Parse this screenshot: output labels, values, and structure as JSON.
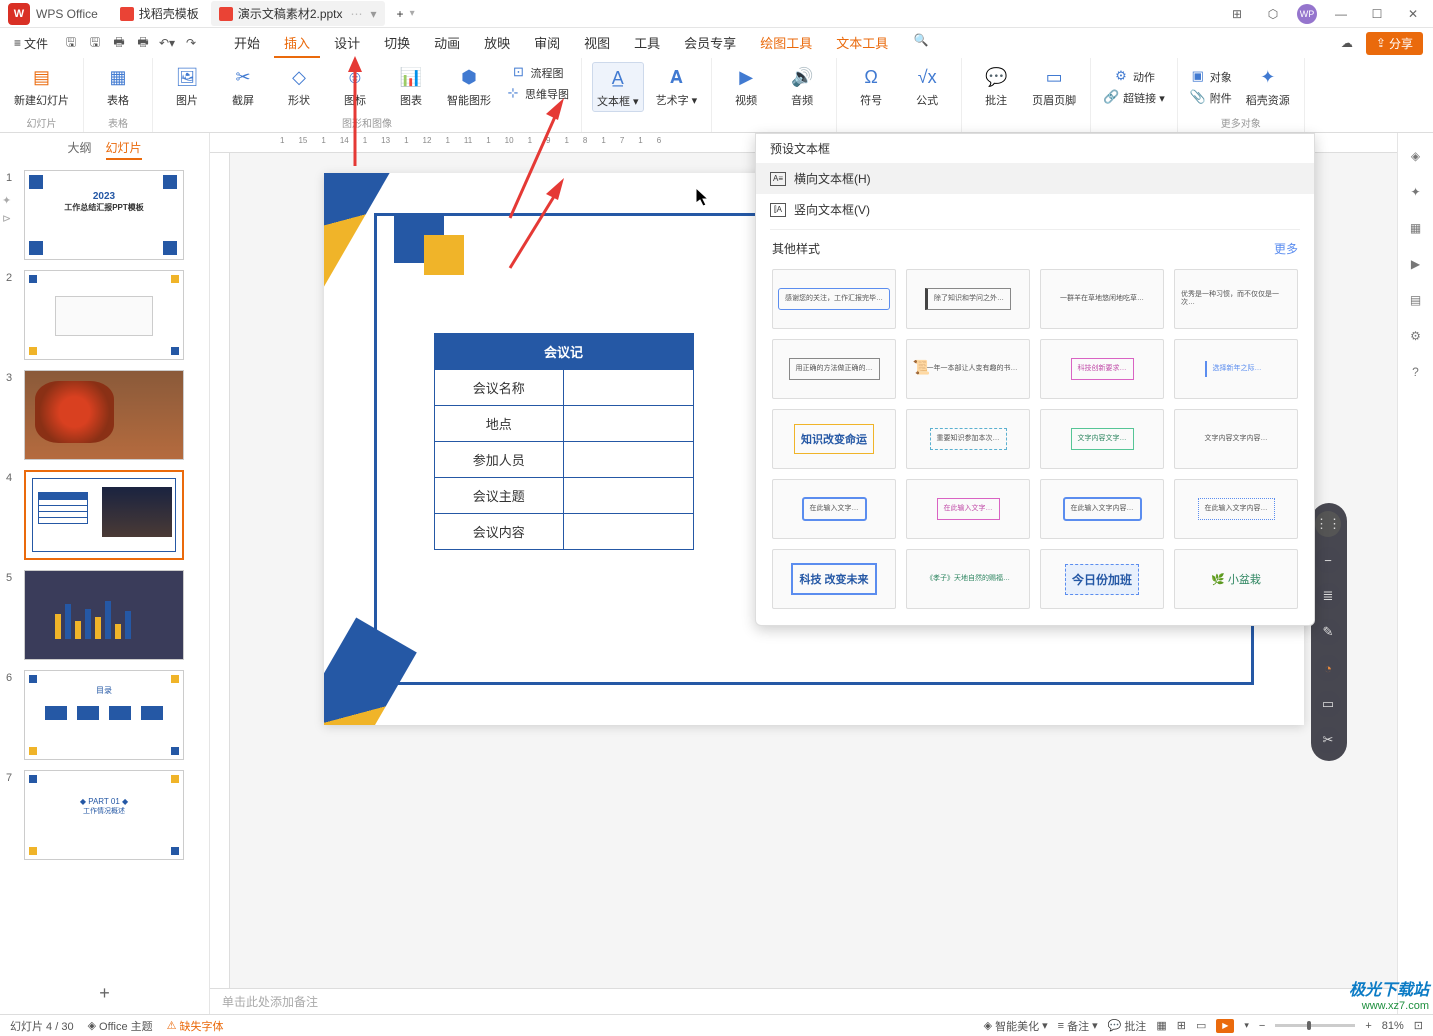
{
  "title_bar": {
    "app_name": "WPS Office",
    "tab1": "找稻壳模板",
    "tab2": "演示文稿素材2.pptx",
    "new_tab": "+"
  },
  "menu": {
    "file": "文件",
    "tabs": {
      "start": "开始",
      "insert": "插入",
      "design": "设计",
      "transition": "切换",
      "animation": "动画",
      "show": "放映",
      "review": "审阅",
      "view": "视图",
      "tools": "工具",
      "member": "会员专享",
      "draw": "绘图工具",
      "text_tool": "文本工具"
    },
    "share": "分享"
  },
  "ribbon": {
    "new_slide": "新建幻灯片",
    "table": "表格",
    "table_group": "表格",
    "picture": "图片",
    "screenshot": "截屏",
    "shape": "形状",
    "icon": "图标",
    "shape_group": "图形和图像",
    "chart": "图表",
    "smartart": "智能图形",
    "flowchart": "流程图",
    "mindmap": "思维导图",
    "textbox": "文本框",
    "wordart": "艺术字",
    "video": "视频",
    "audio": "音频",
    "symbol": "符号",
    "formula": "公式",
    "comment": "批注",
    "header_footer": "页眉页脚",
    "action": "动作",
    "hyperlink": "超链接",
    "object": "对象",
    "attachment": "附件",
    "resource": "稻壳资源",
    "slide_group": "幻灯片",
    "more_objects": "更多对象"
  },
  "slide_panel": {
    "outline": "大纲",
    "slides": "幻灯片",
    "s1": "1",
    "s2": "2",
    "s3": "3",
    "s4": "4",
    "s5": "5",
    "s6": "6",
    "s7": "7"
  },
  "dropdown": {
    "preset": "预设文本框",
    "horizontal": "横向文本框(H)",
    "vertical": "竖向文本框(V)",
    "other_styles": "其他样式",
    "more": "更多",
    "style_tech": "知识改变命运",
    "style_future": "科技 改变未来",
    "style_today": "今日份加班",
    "style_plant": "小盆栽"
  },
  "canvas": {
    "table_title": "会议记",
    "row1": "会议名称",
    "row2": "地点",
    "row3": "参加人员",
    "row4": "会议主题",
    "row5": "会议内容"
  },
  "thumbs": {
    "t1_year": "2023",
    "t1_title": "工作总结汇报PPT模板",
    "t6_title": "目录",
    "t7_part": "PART 01",
    "t7_sub": "工作情况概述"
  },
  "notes": "单击此处添加备注",
  "status": {
    "slide_info": "幻灯片 4 / 30",
    "theme": "Office 主题",
    "missing_font": "缺失字体",
    "beautify": "智能美化",
    "notes": "备注",
    "comments": "批注",
    "zoom": "81%"
  },
  "watermark": {
    "l1": "极光下载站",
    "l2": "www.xz7.com"
  }
}
